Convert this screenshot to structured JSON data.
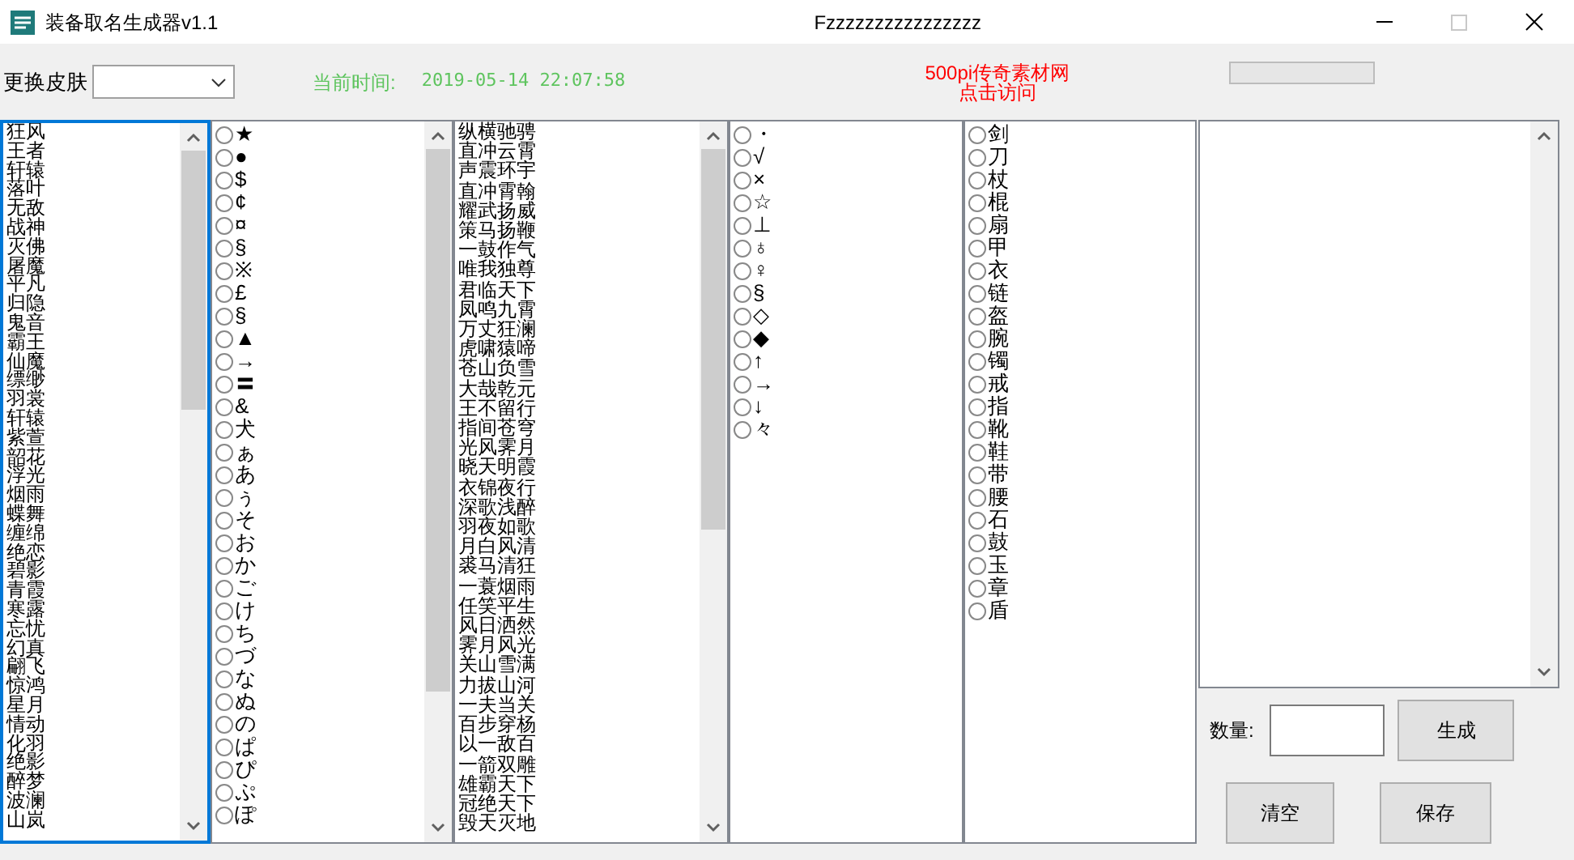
{
  "window": {
    "title": "装备取名生成器v1.1",
    "caption": "Fzzzzzzzzzzzzzzzz",
    "maximize_disabled": true
  },
  "toolbar": {
    "skin_label": "更换皮肤",
    "time_label": "当前时间:",
    "time_value": "2019-05-14 22:07:58",
    "link_line_1": "500pi传奇素材网",
    "link_line_2": "点击访问",
    "progress": {
      "level": 0
    }
  },
  "list_1": [
    "狂风",
    "王者",
    "轩辕",
    "落叶",
    "无敌",
    "战神",
    "灭佛",
    "屠魔",
    "平凡",
    "归隐",
    "鬼音",
    "霸王",
    "仙魔",
    "缥缈",
    "羽裳",
    "轩辕",
    "紫萱",
    "韶花",
    "浮光",
    "烟雨",
    "蝶舞",
    "缠绵",
    "绝恋",
    "碧影",
    "青霞",
    "寒露",
    "忘忧",
    "幻真",
    "翩飞",
    "惊鸿",
    "星月",
    "情动",
    "化羽",
    "绝影",
    "醉梦",
    "波澜",
    "山岚"
  ],
  "list_2": [
    {
      "text": "★",
      "selected": false
    },
    {
      "text": "●",
      "selected": false
    },
    {
      "text": "$",
      "selected": false
    },
    {
      "text": "¢",
      "selected": false
    },
    {
      "text": "¤",
      "selected": false
    },
    {
      "text": "§",
      "selected": false
    },
    {
      "text": "※",
      "selected": false
    },
    {
      "text": "£",
      "selected": false
    },
    {
      "text": "§",
      "selected": false
    },
    {
      "text": "▲",
      "selected": false
    },
    {
      "text": "→",
      "selected": false
    },
    {
      "text": "〓",
      "selected": false
    },
    {
      "text": "&",
      "selected": false
    },
    {
      "text": "犬",
      "selected": false
    },
    {
      "text": "ぁ",
      "selected": false
    },
    {
      "text": "あ",
      "selected": false
    },
    {
      "text": "ぅ",
      "selected": false
    },
    {
      "text": "そ",
      "selected": false
    },
    {
      "text": "お",
      "selected": false
    },
    {
      "text": "か",
      "selected": false
    },
    {
      "text": "ご",
      "selected": false
    },
    {
      "text": "け",
      "selected": false
    },
    {
      "text": "ち",
      "selected": false
    },
    {
      "text": "づ",
      "selected": false
    },
    {
      "text": "な",
      "selected": false
    },
    {
      "text": "ぬ",
      "selected": false
    },
    {
      "text": "の",
      "selected": false
    },
    {
      "text": "ぱ",
      "selected": false
    },
    {
      "text": "ぴ",
      "selected": false
    },
    {
      "text": "ぷ",
      "selected": false
    },
    {
      "text": "ぽ",
      "selected": false
    }
  ],
  "list_3": [
    "纵横驰骋",
    "直冲云霄",
    "声震环宇",
    "直冲霄翰",
    "耀武扬威",
    "策马扬鞭",
    "一鼓作气",
    "唯我独尊",
    "君临天下",
    "凤鸣九霄",
    "万丈狂澜",
    "虎啸猿啼",
    "苍山负雪",
    "大哉乾元",
    "王不留行",
    "指间苍穹",
    "光风霁月",
    "晓天明霞",
    "衣锦夜行",
    "深歌浅醉",
    "羽夜如歌",
    "月白风清",
    "裘马清狂",
    "一蓑烟雨",
    "任笑平生",
    "风日洒然",
    "霁月风光",
    "关山雪满",
    "力拔山河",
    "一夫当关",
    "百步穿杨",
    "以一敌百",
    "一箭双雕",
    "雄霸天下",
    "冠绝天下",
    "毁天灭地"
  ],
  "list_4": [
    {
      "text": "・",
      "selected": false
    },
    {
      "text": "√",
      "selected": false
    },
    {
      "text": "×",
      "selected": false
    },
    {
      "text": "☆",
      "selected": false
    },
    {
      "text": "⊥",
      "selected": false
    },
    {
      "text": "♁",
      "selected": false
    },
    {
      "text": "♀",
      "selected": false
    },
    {
      "text": "§",
      "selected": false
    },
    {
      "text": "◇",
      "selected": false
    },
    {
      "text": "◆",
      "selected": false
    },
    {
      "text": "↑",
      "selected": false
    },
    {
      "text": "→",
      "selected": false
    },
    {
      "text": "↓",
      "selected": false
    },
    {
      "text": "々",
      "selected": false
    }
  ],
  "list_5": [
    {
      "text": "剑",
      "selected": false
    },
    {
      "text": "刀",
      "selected": false
    },
    {
      "text": "杖",
      "selected": false
    },
    {
      "text": "棍",
      "selected": false
    },
    {
      "text": "扇",
      "selected": false
    },
    {
      "text": "甲",
      "selected": false
    },
    {
      "text": "衣",
      "selected": false
    },
    {
      "text": "链",
      "selected": false
    },
    {
      "text": "盔",
      "selected": false
    },
    {
      "text": "腕",
      "selected": false
    },
    {
      "text": "镯",
      "selected": false
    },
    {
      "text": "戒",
      "selected": false
    },
    {
      "text": "指",
      "selected": false
    },
    {
      "text": "靴",
      "selected": false
    },
    {
      "text": "鞋",
      "selected": false
    },
    {
      "text": "带",
      "selected": false
    },
    {
      "text": "腰",
      "selected": false
    },
    {
      "text": "石",
      "selected": false
    },
    {
      "text": "鼓",
      "selected": false
    },
    {
      "text": "玉",
      "selected": false
    },
    {
      "text": "章",
      "selected": false
    },
    {
      "text": "盾",
      "selected": false
    }
  ],
  "controls": {
    "count_label": "数量:",
    "generate": "生成",
    "clear": "清空",
    "save": "保存"
  }
}
